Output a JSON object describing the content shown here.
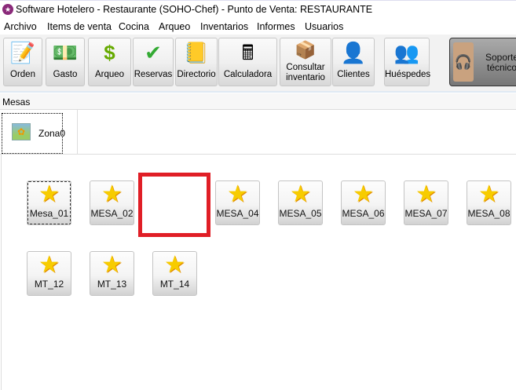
{
  "window": {
    "title": "Software  Hotelero - Restaurante (SOHO-Chef)  - Punto de Venta: RESTAURANTE"
  },
  "menu": [
    "Archivo",
    "Items de venta",
    "Cocina",
    "Arqueo",
    "Inventarios",
    "Informes",
    "Usuarios"
  ],
  "toolbar": [
    {
      "label": "Orden",
      "icon": "order-sheet-icon"
    },
    {
      "label": "Gasto",
      "icon": "money-bundle-icon"
    },
    {
      "label": "Arqueo",
      "icon": "dollar-icon"
    },
    {
      "label": "Reservas",
      "icon": "calendar-check-icon"
    },
    {
      "label": "Directorio",
      "icon": "address-book-icon"
    },
    {
      "label": "Calculadora",
      "icon": "calculator-icon"
    },
    {
      "label": "Consultar inventario",
      "icon": "box-icon"
    },
    {
      "label": "Clientes",
      "icon": "user-icon"
    },
    {
      "label": "Huéspedes",
      "icon": "guests-icon"
    }
  ],
  "support": {
    "label": "Soporte técnico",
    "icon": "support-agent-icon"
  },
  "section": {
    "label": "Mesas"
  },
  "zone": {
    "label": "Zona0",
    "icon": "sunflower-image-icon"
  },
  "tables": [
    "Mesa_01",
    "MESA_02",
    "MESA_04",
    "MESA_05",
    "MESA_06",
    "MESA_07",
    "MESA_08",
    "MT_12",
    "MT_13",
    "MT_14"
  ],
  "colors": {
    "highlight": "#e01e26",
    "star": "#f7cc00"
  }
}
